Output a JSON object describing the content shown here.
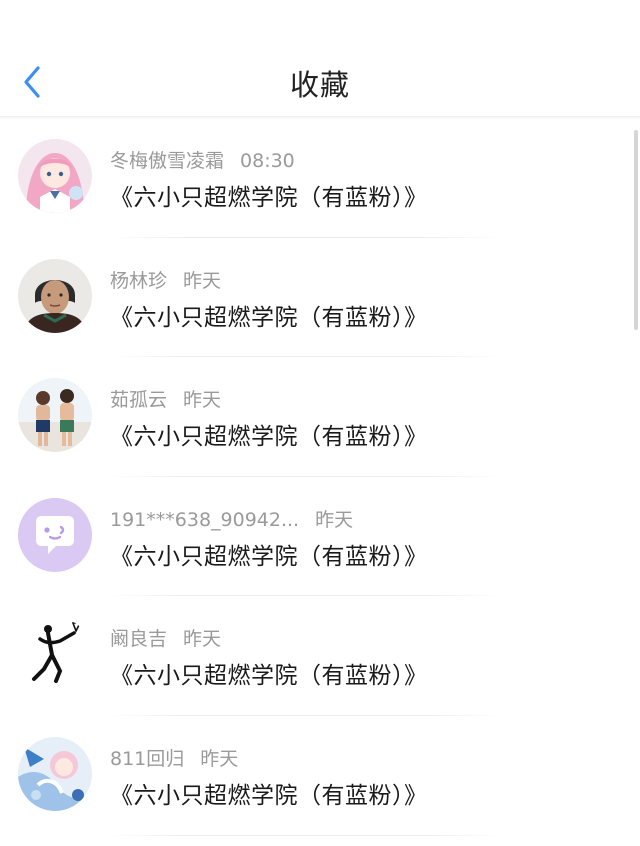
{
  "header": {
    "title": "收藏",
    "back_icon": "chevron-left-icon",
    "accent_color": "#3a8ef6"
  },
  "items": [
    {
      "name": "冬梅傲雪凌霜",
      "time": "08:30",
      "content": "《六小只超燃学院（有蓝粉）》",
      "avatar": "anime-girl-avatar"
    },
    {
      "name": "杨林珍",
      "time": "昨天",
      "content": "《六小只超燃学院（有蓝粉）》",
      "avatar": "elderly-woman-avatar"
    },
    {
      "name": "茹孤云",
      "time": "昨天",
      "content": "《六小只超燃学院（有蓝粉）》",
      "avatar": "boys-beach-avatar"
    },
    {
      "name": "191***638_90942...",
      "time": "昨天",
      "content": "《六小只超燃学院（有蓝粉）》",
      "avatar": "chat-bubble-avatar"
    },
    {
      "name": "阚良吉",
      "time": "昨天",
      "content": "《六小只超燃学院（有蓝粉）》",
      "avatar": "stick-figure-avatar"
    },
    {
      "name": "811回归",
      "time": "昨天",
      "content": "《六小只超燃学院（有蓝粉）》",
      "avatar": "anime-art-avatar"
    }
  ]
}
